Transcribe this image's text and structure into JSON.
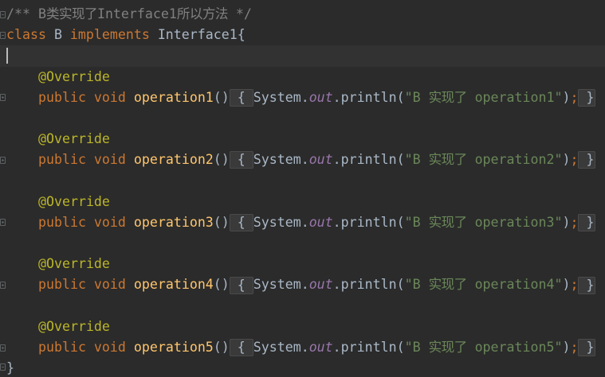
{
  "colors": {
    "background": "#2B2B2B",
    "current_line": "#323232",
    "default_text": "#A9B7C6",
    "keyword": "#CC7832",
    "method_declaration": "#FFC66D",
    "annotation": "#BBB529",
    "string": "#6A8759",
    "comment": "#808080",
    "static_field": "#9876AA",
    "fold_placeholder_bg": "#3A3A3A",
    "caret": "#BBBBBB"
  },
  "editor": {
    "doc_comment": {
      "text": "/** B类实现了Interface1所以方法 */",
      "fold_icon": "fold-collapse-icon"
    },
    "class_decl": {
      "keyword": "class",
      "name": "B",
      "implements_keyword": "implements",
      "interface": "Interface1",
      "open_brace": "{",
      "fold_icon": "fold-collapse-icon"
    },
    "methods": [
      {
        "annotation": "@Override",
        "modifiers": "public void",
        "name": "operation1",
        "params": "()",
        "body_open": "{",
        "receiver": "System.",
        "field": "out",
        "call": ".println(",
        "string_literal": "\"B 实现了 operation1\"",
        "close_paren": ")",
        "semicolon": ";",
        "body_close": "}",
        "fold_icon": "fold-expand-icon"
      },
      {
        "annotation": "@Override",
        "modifiers": "public void",
        "name": "operation2",
        "params": "()",
        "body_open": "{",
        "receiver": "System.",
        "field": "out",
        "call": ".println(",
        "string_literal": "\"B 实现了 operation2\"",
        "close_paren": ")",
        "semicolon": ";",
        "body_close": "}",
        "fold_icon": "fold-expand-icon"
      },
      {
        "annotation": "@Override",
        "modifiers": "public void",
        "name": "operation3",
        "params": "()",
        "body_open": "{",
        "receiver": "System.",
        "field": "out",
        "call": ".println(",
        "string_literal": "\"B 实现了 operation3\"",
        "close_paren": ")",
        "semicolon": ";",
        "body_close": "}",
        "fold_icon": "fold-expand-icon"
      },
      {
        "annotation": "@Override",
        "modifiers": "public void",
        "name": "operation4",
        "params": "()",
        "body_open": "{",
        "receiver": "System.",
        "field": "out",
        "call": ".println(",
        "string_literal": "\"B 实现了 operation4\"",
        "close_paren": ")",
        "semicolon": ";",
        "body_close": "}",
        "fold_icon": "fold-expand-icon"
      },
      {
        "annotation": "@Override",
        "modifiers": "public void",
        "name": "operation5",
        "params": "()",
        "body_open": "{",
        "receiver": "System.",
        "field": "out",
        "call": ".println(",
        "string_literal": "\"B 实现了 operation5\"",
        "close_paren": ")",
        "semicolon": ";",
        "body_close": "}",
        "fold_icon": "fold-expand-icon"
      }
    ],
    "closing_brace": {
      "text": "}",
      "fold_icon": "fold-end-icon"
    }
  }
}
